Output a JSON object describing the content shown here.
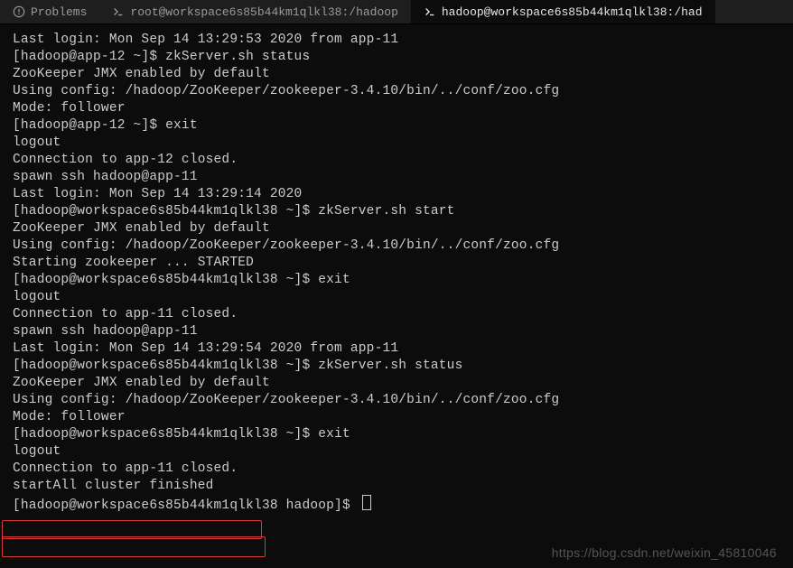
{
  "tabs": {
    "problems": "Problems",
    "root": "root@workspace6s85b44km1qlkl38:/hadoop",
    "hadoop": "hadoop@workspace6s85b44km1qlkl38:/had"
  },
  "lines": {
    "l0": "Last login: Mon Sep 14 13:29:53 2020 from app-11",
    "l1": "[hadoop@app-12 ~]$ zkServer.sh status",
    "l2": "ZooKeeper JMX enabled by default",
    "l3": "Using config: /hadoop/ZooKeeper/zookeeper-3.4.10/bin/../conf/zoo.cfg",
    "l4": "Mode: follower",
    "l5": "[hadoop@app-12 ~]$ exit",
    "l6": "logout",
    "l7": "Connection to app-12 closed.",
    "l8": "spawn ssh hadoop@app-11",
    "l9": "Last login: Mon Sep 14 13:29:14 2020",
    "l10": "[hadoop@workspace6s85b44km1qlkl38 ~]$ zkServer.sh start",
    "l11": "ZooKeeper JMX enabled by default",
    "l12": "Using config: /hadoop/ZooKeeper/zookeeper-3.4.10/bin/../conf/zoo.cfg",
    "l13": "Starting zookeeper ... STARTED",
    "l14": "[hadoop@workspace6s85b44km1qlkl38 ~]$ exit",
    "l15": "logout",
    "l16": "Connection to app-11 closed.",
    "l17": "spawn ssh hadoop@app-11",
    "l18": "Last login: Mon Sep 14 13:29:54 2020 from app-11",
    "l19": "[hadoop@workspace6s85b44km1qlkl38 ~]$ zkServer.sh status",
    "l20": "ZooKeeper JMX enabled by default",
    "l21": "Using config: /hadoop/ZooKeeper/zookeeper-3.4.10/bin/../conf/zoo.cfg",
    "l22": "Mode: follower",
    "l23": "[hadoop@workspace6s85b44km1qlkl38 ~]$ exit",
    "l24": "logout",
    "l25": "Connection to app-11 closed.",
    "l26": "startAll cluster finished",
    "l27": "[hadoop@workspace6s85b44km1qlkl38 hadoop]$ "
  },
  "watermark": "https://blog.csdn.net/weixin_45810046"
}
